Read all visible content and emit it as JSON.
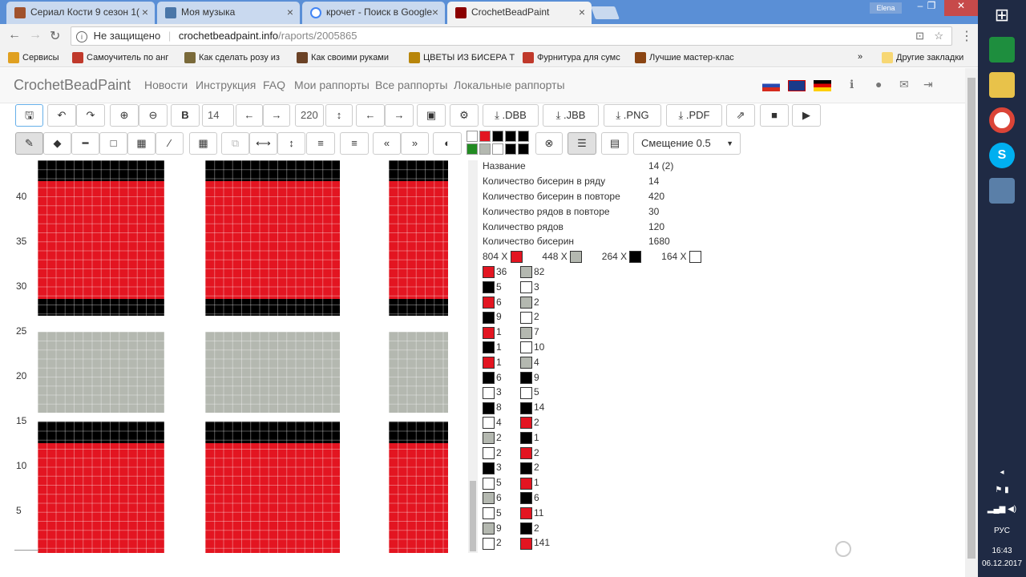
{
  "tabs": [
    {
      "label": "Сериал Кости 9 сезон 1(",
      "icon_color": "#a0522d"
    },
    {
      "label": "Моя музыка",
      "icon_color": "#4a76a8"
    },
    {
      "label": "крочет - Поиск в Google",
      "icon_color": "#4285f4"
    },
    {
      "label": "CrochetBeadPaint",
      "icon_color": "#8b0000"
    }
  ],
  "window": {
    "user": "Elena",
    "minimize": "–",
    "restore": "❐",
    "close": "✕"
  },
  "address": {
    "security": "Не защищено",
    "domain": "crochetbeadpaint.info",
    "path": "/raports/2005865"
  },
  "bookmarks": [
    {
      "label": "Сервисы",
      "color": "#e0a020"
    },
    {
      "label": "Самоучитель по анг",
      "color": "#c0392b"
    },
    {
      "label": "Как сделать розу из",
      "color": "#7a6a3a"
    },
    {
      "label": "Как своими руками",
      "color": "#6b4226"
    },
    {
      "label": "ЦВЕТЫ ИЗ БИСЕРА Т",
      "color": "#b8860b"
    },
    {
      "label": "Фурнитура для сумс",
      "color": "#c0392b"
    },
    {
      "label": "Лучшие мастер-клас",
      "color": "#8b4513"
    }
  ],
  "bookmarks_more": "»",
  "bookmarks_other": "Другие закладки",
  "site": {
    "brand": "CrochetBeadPaint",
    "nav": [
      "Новости",
      "Инструкция",
      "FAQ",
      "Мои раппорты",
      "Все раппорты",
      "Локальные раппорты"
    ]
  },
  "toolbar1": {
    "bold": "B",
    "width": "14",
    "height": "220",
    "dbb": "DBB",
    ".jbb": ".JBB",
    "png": ".PNG",
    "pdf": ".PDF"
  },
  "shift_select": "Смещение 0.5",
  "palette_top": [
    "#ffffff",
    "#e31521",
    "#000000",
    "#000000",
    "#000000"
  ],
  "palette_bottom": [
    "#228b22",
    "#b4b8b0",
    "#ffffff",
    "#000000",
    "#000000"
  ],
  "info": {
    "rows": [
      {
        "label": "Название",
        "value": "14 (2)"
      },
      {
        "label": "Количество бисерин в ряду",
        "value": "14"
      },
      {
        "label": "Количество бисерин в повторе",
        "value": "420"
      },
      {
        "label": "Количество рядов в повторе",
        "value": "30"
      },
      {
        "label": "Количество рядов",
        "value": "120"
      },
      {
        "label": "Количество бисерин",
        "value": "1680"
      }
    ],
    "totals": [
      {
        "count": "804 X",
        "color": "#e31521"
      },
      {
        "count": "448 X",
        "color": "#b4b8b0"
      },
      {
        "count": "264 X",
        "color": "#000000"
      },
      {
        "count": "164 X",
        "color": "#ffffff"
      }
    ]
  },
  "bead_list_left": [
    {
      "c": "#e31521",
      "n": "36"
    },
    {
      "c": "#000000",
      "n": "5"
    },
    {
      "c": "#e31521",
      "n": "6"
    },
    {
      "c": "#000000",
      "n": "9"
    },
    {
      "c": "#e31521",
      "n": "1"
    },
    {
      "c": "#000000",
      "n": "1"
    },
    {
      "c": "#e31521",
      "n": "1"
    },
    {
      "c": "#000000",
      "n": "6"
    },
    {
      "c": "#ffffff",
      "n": "3"
    },
    {
      "c": "#000000",
      "n": "8"
    },
    {
      "c": "#ffffff",
      "n": "4"
    },
    {
      "c": "#b4b8b0",
      "n": "2"
    },
    {
      "c": "#ffffff",
      "n": "2"
    },
    {
      "c": "#000000",
      "n": "3"
    },
    {
      "c": "#ffffff",
      "n": "5"
    },
    {
      "c": "#b4b8b0",
      "n": "6"
    },
    {
      "c": "#ffffff",
      "n": "5"
    },
    {
      "c": "#b4b8b0",
      "n": "9"
    },
    {
      "c": "#ffffff",
      "n": "2"
    }
  ],
  "bead_list_right": [
    {
      "c": "#b4b8b0",
      "n": "82"
    },
    {
      "c": "#ffffff",
      "n": "3"
    },
    {
      "c": "#b4b8b0",
      "n": "2"
    },
    {
      "c": "#ffffff",
      "n": "2"
    },
    {
      "c": "#b4b8b0",
      "n": "7"
    },
    {
      "c": "#ffffff",
      "n": "10"
    },
    {
      "c": "#b4b8b0",
      "n": "4"
    },
    {
      "c": "#000000",
      "n": "9"
    },
    {
      "c": "#ffffff",
      "n": "5"
    },
    {
      "c": "#000000",
      "n": "14"
    },
    {
      "c": "#e31521",
      "n": "2"
    },
    {
      "c": "#000000",
      "n": "1"
    },
    {
      "c": "#e31521",
      "n": "2"
    },
    {
      "c": "#000000",
      "n": "2"
    },
    {
      "c": "#e31521",
      "n": "1"
    },
    {
      "c": "#000000",
      "n": "6"
    },
    {
      "c": "#e31521",
      "n": "11"
    },
    {
      "c": "#000000",
      "n": "2"
    },
    {
      "c": "#e31521",
      "n": "141"
    }
  ],
  "row_labels": [
    "40",
    "35",
    "30",
    "25",
    "20",
    "15",
    "10",
    "5"
  ],
  "colors": {
    "red": "#e31521",
    "black": "#000000",
    "grey": "#b4b8b0",
    "white": "#ffffff"
  },
  "taskbar": {
    "lang": "РУС",
    "time": "16:43",
    "date": "06.12.2017"
  }
}
